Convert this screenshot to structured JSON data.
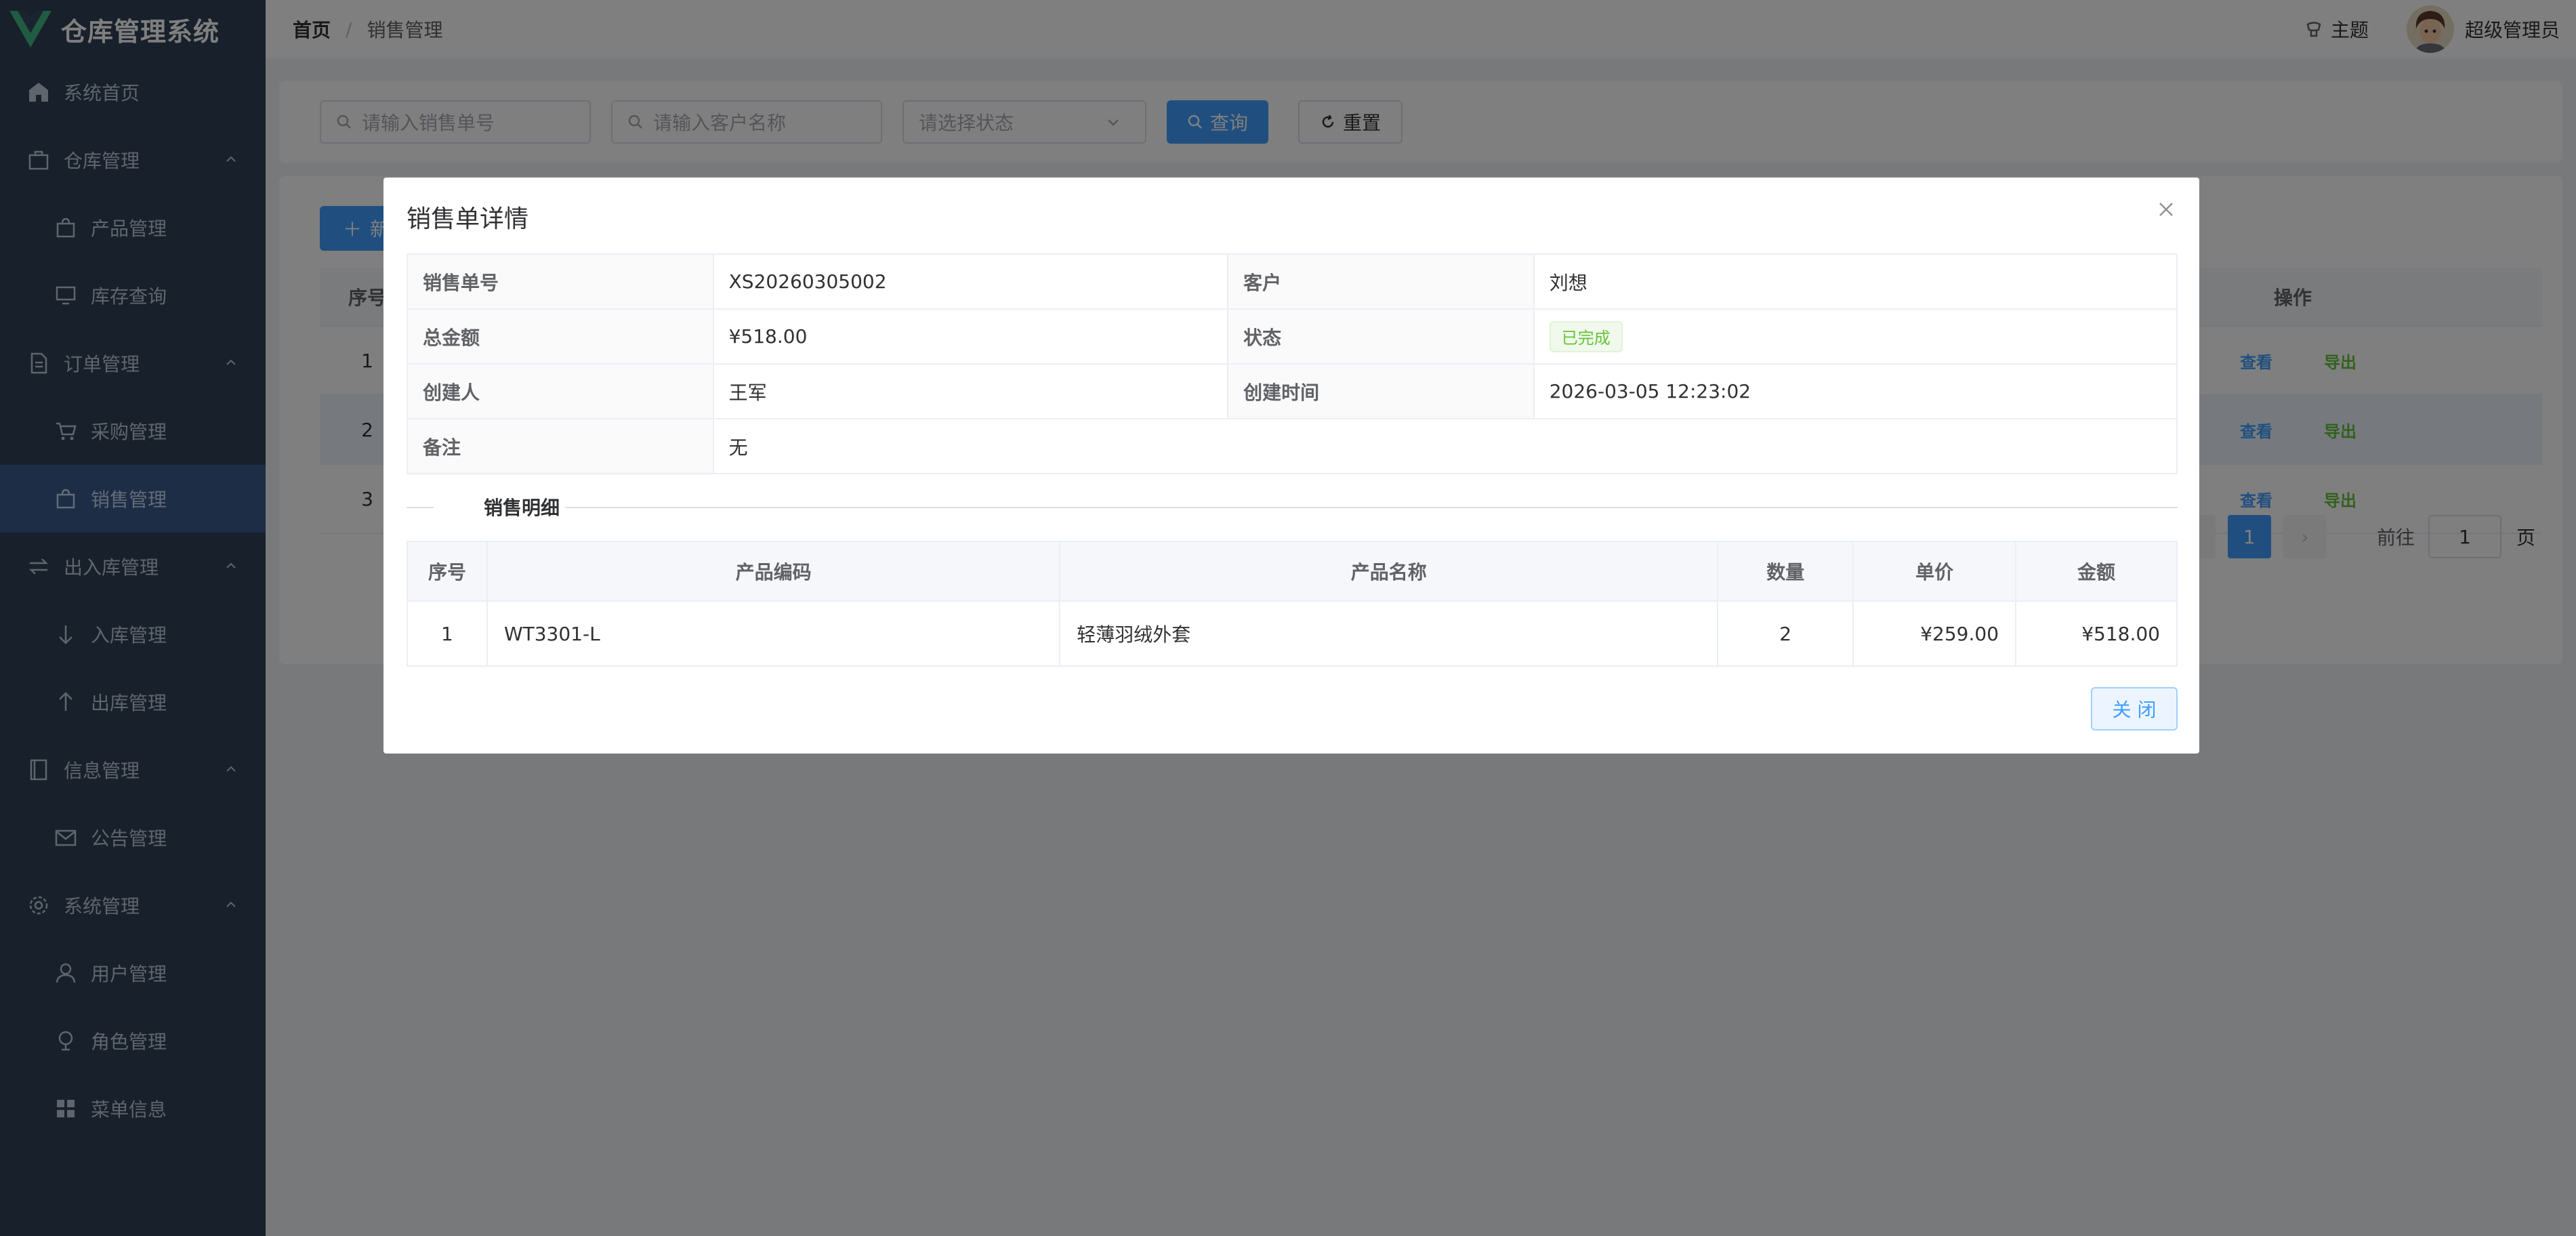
{
  "app": {
    "title": "仓库管理系统"
  },
  "sidebar": {
    "items": [
      {
        "label": "系统首页",
        "icon": "home-icon",
        "level": "top"
      },
      {
        "label": "仓库管理",
        "icon": "warehouse-icon",
        "level": "top",
        "expanded": true
      },
      {
        "label": "产品管理",
        "icon": "bag-icon",
        "level": "sub"
      },
      {
        "label": "库存查询",
        "icon": "monitor-icon",
        "level": "sub"
      },
      {
        "label": "订单管理",
        "icon": "document-icon",
        "level": "top",
        "expanded": true
      },
      {
        "label": "采购管理",
        "icon": "cart-icon",
        "level": "sub"
      },
      {
        "label": "销售管理",
        "icon": "sale-bag-icon",
        "level": "sub",
        "active": true
      },
      {
        "label": "出入库管理",
        "icon": "switch-icon",
        "level": "top",
        "expanded": true
      },
      {
        "label": "入库管理",
        "icon": "arrow-down-icon",
        "level": "sub"
      },
      {
        "label": "出库管理",
        "icon": "arrow-up-icon",
        "level": "sub"
      },
      {
        "label": "信息管理",
        "icon": "notebook-icon",
        "level": "top",
        "expanded": true
      },
      {
        "label": "公告管理",
        "icon": "message-icon",
        "level": "sub"
      },
      {
        "label": "系统管理",
        "icon": "gear-icon",
        "level": "top",
        "expanded": true
      },
      {
        "label": "用户管理",
        "icon": "user-icon",
        "level": "sub"
      },
      {
        "label": "角色管理",
        "icon": "role-icon",
        "level": "sub"
      },
      {
        "label": "菜单信息",
        "icon": "grid-icon",
        "level": "sub"
      }
    ]
  },
  "header": {
    "breadcrumb": {
      "home": "首页",
      "separator": "/",
      "current": "销售管理"
    },
    "theme_label": "主题",
    "user_name": "超级管理员"
  },
  "search": {
    "order_no_placeholder": "请输入销售单号",
    "customer_placeholder": "请输入客户名称",
    "status_placeholder": "请选择状态",
    "query_label": "查询",
    "reset_label": "重置"
  },
  "table": {
    "add_label": "新增",
    "index_header": "序号",
    "ops_header": "操作",
    "view_label": "查看",
    "export_label": "导出",
    "rows": [
      "1",
      "2",
      "3"
    ]
  },
  "pagination": {
    "current_page": "1",
    "goto_label": "前往",
    "goto_value": "1",
    "page_suffix": "页"
  },
  "dialog": {
    "title": "销售单详情",
    "fields": {
      "order_no_label": "销售单号",
      "order_no": "XS20260305002",
      "customer_label": "客户",
      "customer": "刘想",
      "total_label": "总金额",
      "total": "¥518.00",
      "status_label": "状态",
      "status": "已完成",
      "creator_label": "创建人",
      "creator": "王军",
      "created_at_label": "创建时间",
      "created_at": "2026-03-05 12:23:02",
      "remark_label": "备注",
      "remark": "无"
    },
    "section_title": "销售明细",
    "detail_headers": [
      "序号",
      "产品编码",
      "产品名称",
      "数量",
      "单价",
      "金额"
    ],
    "detail_rows": [
      {
        "index": "1",
        "code": "WT3301-L",
        "name": "轻薄羽绒外套",
        "qty": "2",
        "price": "¥259.00",
        "amount": "¥518.00"
      }
    ],
    "close_label": "关 闭"
  },
  "colors": {
    "primary": "#409eff",
    "success": "#67c23a",
    "sidebar_bg": "#304156",
    "active_bg": "#3a5a8c"
  }
}
